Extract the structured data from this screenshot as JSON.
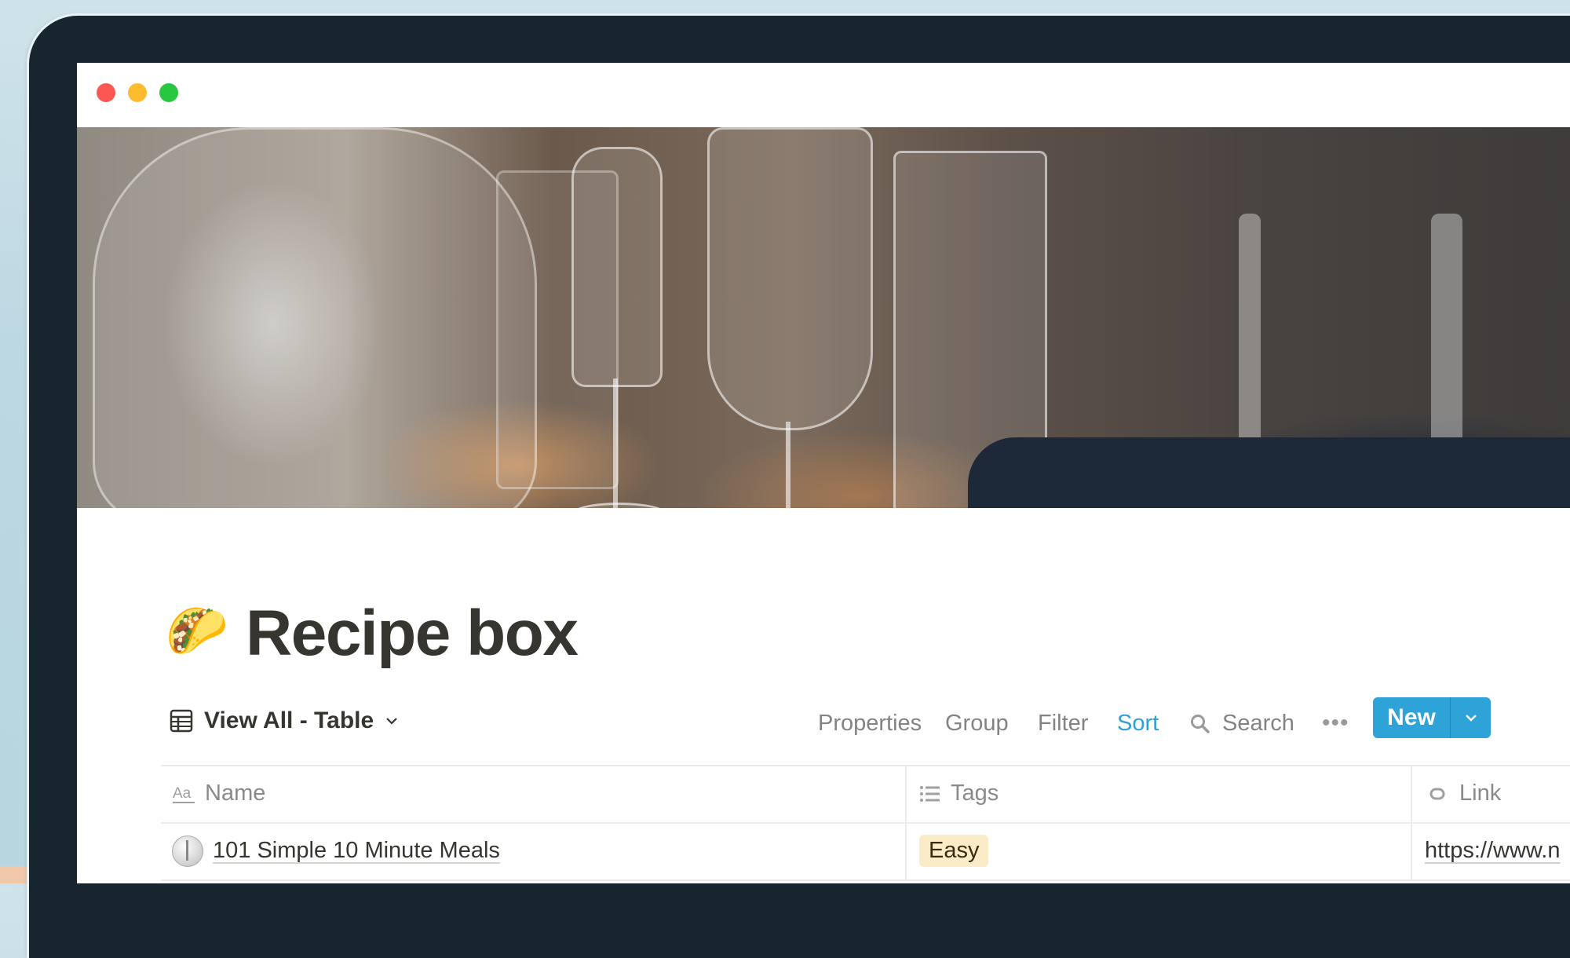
{
  "window": {
    "controls": [
      "close",
      "minimize",
      "maximize"
    ],
    "colors": {
      "close": "#fc5753",
      "minimize": "#fdbc2e",
      "maximize": "#27c840"
    }
  },
  "cover": {
    "description": "Restaurant table with wine glasses"
  },
  "page": {
    "icon": "🌮",
    "icon_name": "taco-emoji",
    "title": "Recipe box"
  },
  "toolbar": {
    "view_label": "View All - Table",
    "properties": "Properties",
    "group": "Group",
    "filter": "Filter",
    "sort": "Sort",
    "search": "Search",
    "more": "•••",
    "new": "New",
    "accent_color": "#2ea3d8"
  },
  "table": {
    "columns": [
      {
        "label": "Name",
        "icon": "text-aa-icon"
      },
      {
        "label": "Tags",
        "icon": "list-icon"
      },
      {
        "label": "Link",
        "icon": "link-icon"
      }
    ],
    "rows": [
      {
        "icon": "stopwatch-icon",
        "name": "101 Simple 10 Minute Meals",
        "tag": "Easy",
        "tag_color": "#fbecc8",
        "link": "https://www.n"
      }
    ]
  }
}
